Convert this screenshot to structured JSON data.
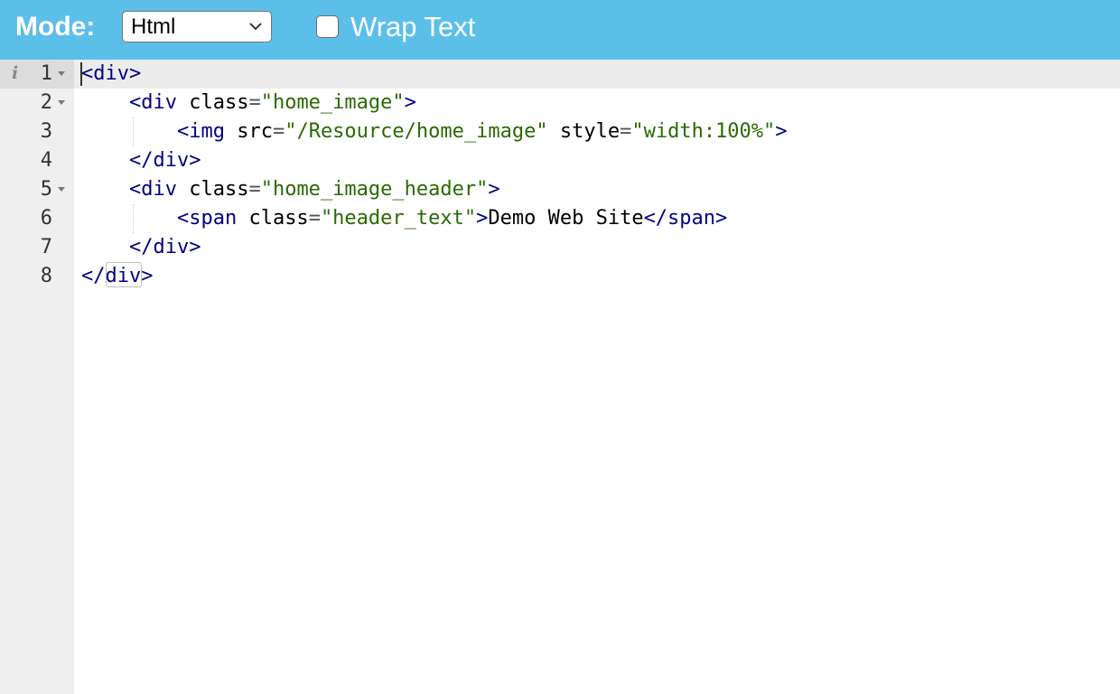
{
  "toolbar": {
    "mode_label": "Mode:",
    "mode_value": "Html",
    "wrap_label": "Wrap Text",
    "wrap_checked": false,
    "background": "#5bbfea"
  },
  "editor": {
    "lines": [
      {
        "number": "1",
        "foldable": true
      },
      {
        "number": "2",
        "foldable": true
      },
      {
        "number": "3",
        "foldable": false
      },
      {
        "number": "4",
        "foldable": false
      },
      {
        "number": "5",
        "foldable": true
      },
      {
        "number": "6",
        "foldable": false
      },
      {
        "number": "7",
        "foldable": false
      },
      {
        "number": "8",
        "foldable": false
      }
    ],
    "code": {
      "l1": {
        "open": "<div>"
      },
      "l2": {
        "open": "<div",
        "attr": "class",
        "eq": "=",
        "value": "\"home_image\"",
        "close": ">"
      },
      "l3": {
        "open": "<img",
        "attr1": "src",
        "eq1": "=",
        "value1": "\"/Resource/home_image\"",
        "attr2": "style",
        "eq2": "=",
        "value2": "\"width:100%\"",
        "close": ">"
      },
      "l4": {
        "close_tag": "</div>"
      },
      "l5": {
        "open": "<div",
        "attr": "class",
        "eq": "=",
        "value": "\"home_image_header\"",
        "close": ">"
      },
      "l6": {
        "open": "<span",
        "attr": "class",
        "eq": "=",
        "value": "\"header_text\"",
        "close": ">",
        "text": "Demo Web Site",
        "end_tag": "</span>"
      },
      "l7": {
        "close_tag": "</div>"
      },
      "l8": {
        "close_tag": "</div>"
      }
    },
    "icons": {
      "info": "info-icon",
      "fold": "fold-arrow-icon",
      "select": "chevron-down-icon"
    }
  }
}
